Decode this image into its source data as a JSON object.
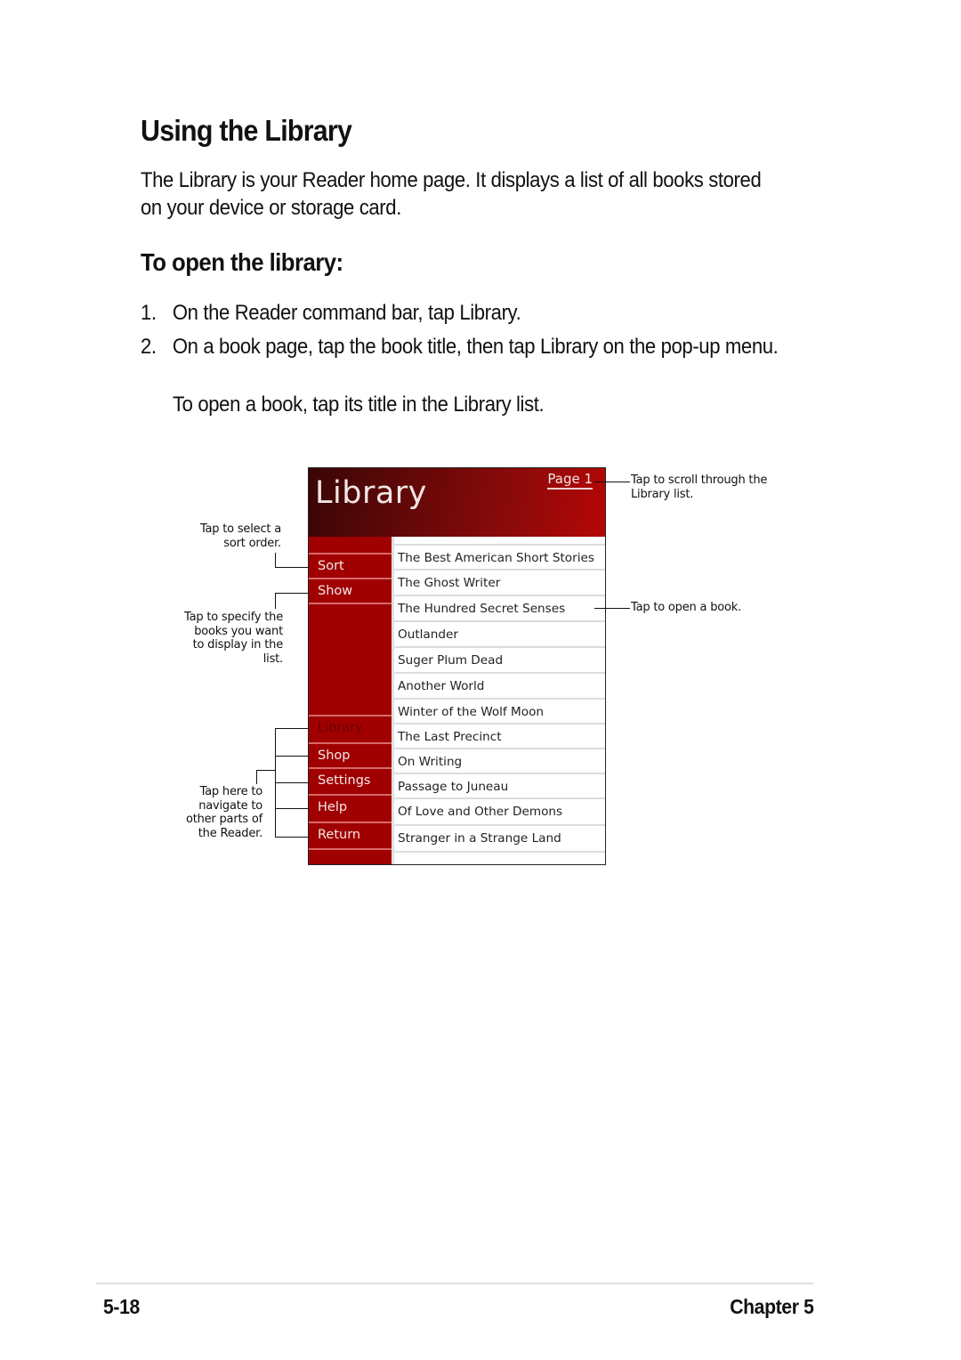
{
  "heading": "Using the Library",
  "intro": "The Library is your Reader home page. It displays a list of all books stored on your device or storage card.",
  "subheading": "To open the library:",
  "steps": [
    {
      "number": "1.",
      "text": "On the Reader command bar, tap Library."
    },
    {
      "number": "2.",
      "text": "On a book page, tap the book title, then tap Library on the pop-up menu."
    }
  ],
  "note": "To open a book, tap its title in the Library list.",
  "screen": {
    "title": "Library",
    "page_link": "Page 1",
    "top_menu": [
      "Sort",
      "Show"
    ],
    "bottom_menu": [
      "Library",
      "Shop",
      "Settings",
      "Help",
      "Return"
    ],
    "active_menu": "Library",
    "books": [
      "The Best American Short Stories",
      "The Ghost Writer",
      "The Hundred Secret Senses",
      "Outlander",
      "Suger Plum Dead",
      "Another World",
      "Winter of the Wolf Moon",
      "The Last Precinct",
      "On Writing",
      "Passage to Juneau",
      "Of Love and Other Demons",
      "Stranger in a Strange Land"
    ],
    "colors": {
      "header_dark": "#3a0606",
      "header_bright": "#b60606",
      "sidebar": "#a00000"
    }
  },
  "callouts": {
    "sort": "Tap to select a sort order.",
    "show": "Tap to specify the books you want to display in the list.",
    "navigate": "Tap here to navigate to other parts of the Reader.",
    "scroll": "Tap to scroll through the Library list.",
    "open_book": "Tap to open a book."
  },
  "footer": {
    "page_number": "5-18",
    "chapter": "Chapter 5"
  }
}
